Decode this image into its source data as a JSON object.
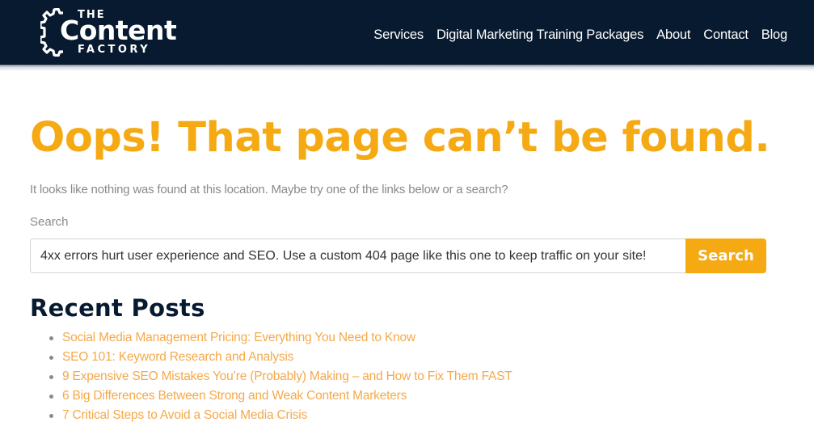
{
  "brand": {
    "logo_icon": "gear-icon",
    "logo_the": "THE",
    "logo_content": "Content",
    "logo_factory": "FACTORY"
  },
  "nav": {
    "items": [
      {
        "label": "Services"
      },
      {
        "label": "Digital Marketing Training Packages"
      },
      {
        "label": "About"
      },
      {
        "label": "Contact"
      },
      {
        "label": "Blog"
      }
    ]
  },
  "main": {
    "title": "Oops! That page can’t be found.",
    "intro": "It looks like nothing was found at this location. Maybe try one of the links below or a search?",
    "search": {
      "label": "Search",
      "value": "4xx errors hurt user experience and SEO. Use a custom 404 page like this one to keep traffic on your site!",
      "button_label": "Search"
    },
    "recent_posts": {
      "title": "Recent Posts",
      "items": [
        {
          "label": "Social Media Management Pricing: Everything You Need to Know"
        },
        {
          "label": "SEO 101: Keyword Research and Analysis"
        },
        {
          "label": "9 Expensive SEO Mistakes You’re (Probably) Making – and How to Fix Them FAST"
        },
        {
          "label": "6 Big Differences Between Strong and Weak Content Marketers"
        },
        {
          "label": "7 Critical Steps to Avoid a Social Media Crisis"
        }
      ]
    }
  },
  "colors": {
    "header_bg": "#071a30",
    "accent": "#f5a913",
    "link": "#f5a94a",
    "heading_dark": "#071a30",
    "muted_text": "#8a8a8a"
  }
}
